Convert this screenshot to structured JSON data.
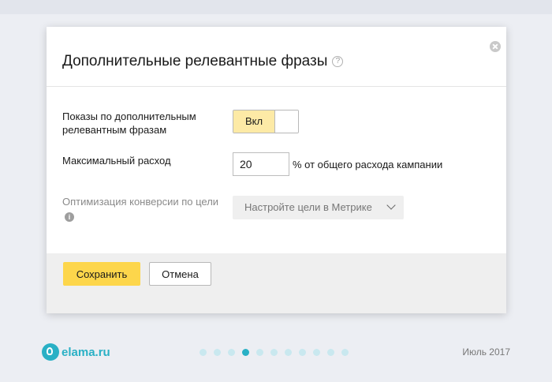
{
  "dialog": {
    "title": "Дополнительные релевантные фразы",
    "help_icon": "question-icon",
    "close_icon": "close-icon"
  },
  "form": {
    "impressions_label": "Показы по дополнительным релевантным фразам",
    "toggle_on_label": "Вкл",
    "max_spend_label": "Максимальный расход",
    "max_spend_value": "20",
    "max_spend_suffix": "% от общего расхода кампании",
    "optimization_label": "Оптимизация конверсии по цели",
    "optimization_select": "Настройте цели в Метрике"
  },
  "footer": {
    "save_label": "Сохранить",
    "cancel_label": "Отмена"
  },
  "page": {
    "brand": "elama.ru",
    "date": "Июль 2017",
    "pager_total": 11,
    "pager_active": 4
  },
  "colors": {
    "accent": "#fdd64b",
    "toggle_on": "#fdeaa6",
    "brand": "#29b0c5"
  }
}
